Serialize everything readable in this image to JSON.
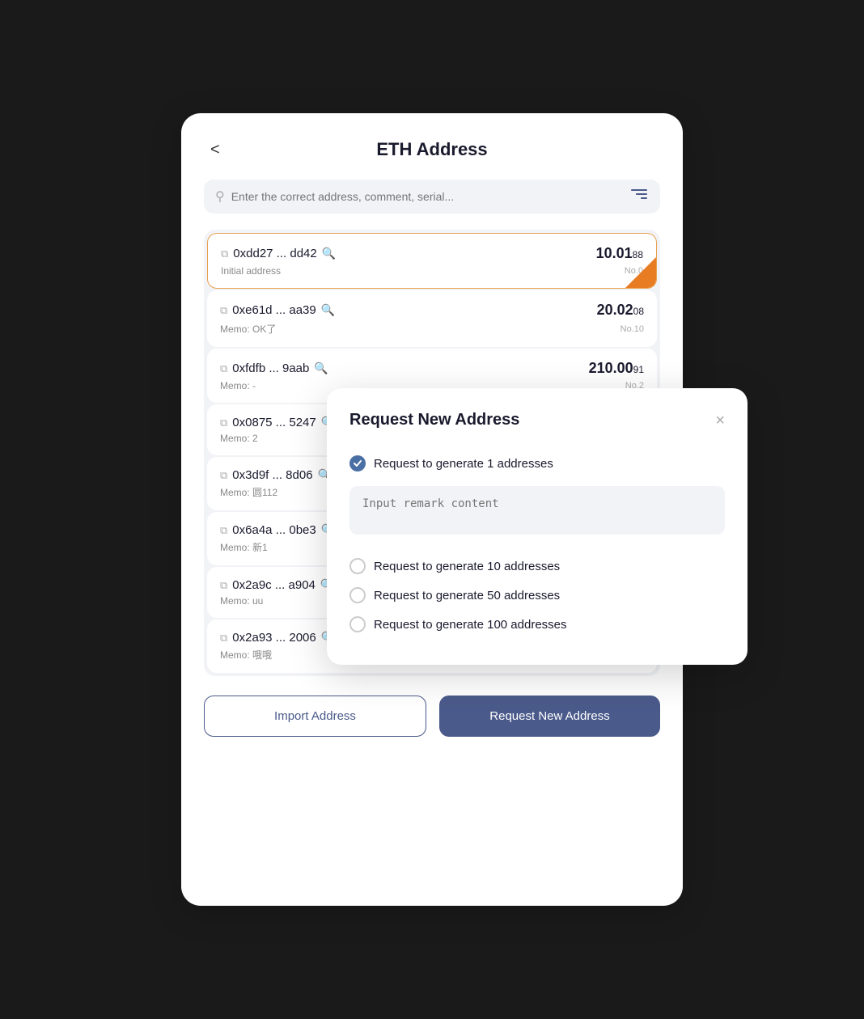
{
  "header": {
    "title": "ETH Address",
    "back_label": "<"
  },
  "search": {
    "placeholder": "Enter the correct address, comment, serial..."
  },
  "address_list": [
    {
      "address": "0xdd27 ... dd42",
      "label": "Initial address",
      "amount_main": "10.01",
      "amount_dec": "88",
      "no": "No.0",
      "active": true
    },
    {
      "address": "0xe61d ... aa39",
      "label": "Memo: OK了",
      "amount_main": "20.02",
      "amount_dec": "08",
      "no": "No.10",
      "active": false
    },
    {
      "address": "0xfdfb ... 9aab",
      "label": "Memo: -",
      "amount_main": "210.00",
      "amount_dec": "91",
      "no": "No.2",
      "active": false
    },
    {
      "address": "0x0875 ... 5247",
      "label": "Memo: 2",
      "amount_main": "",
      "amount_dec": "",
      "no": "",
      "active": false
    },
    {
      "address": "0x3d9f ... 8d06",
      "label": "Memo: 圆112",
      "amount_main": "",
      "amount_dec": "",
      "no": "",
      "active": false
    },
    {
      "address": "0x6a4a ... 0be3",
      "label": "Memo: 新1",
      "amount_main": "",
      "amount_dec": "",
      "no": "",
      "active": false
    },
    {
      "address": "0x2a9c ... a904",
      "label": "Memo: uu",
      "amount_main": "",
      "amount_dec": "",
      "no": "",
      "active": false
    },
    {
      "address": "0x2a93 ... 2006",
      "label": "Memo: 哦哦",
      "amount_main": "",
      "amount_dec": "",
      "no": "",
      "active": false
    }
  ],
  "buttons": {
    "import": "Import Address",
    "request": "Request New Address"
  },
  "modal": {
    "title": "Request New Address",
    "close_label": "×",
    "options": [
      {
        "label": "Request to generate 1 addresses",
        "checked": true
      },
      {
        "label": "Request to generate 10 addresses",
        "checked": false
      },
      {
        "label": "Request to generate 50 addresses",
        "checked": false
      },
      {
        "label": "Request to generate 100 addresses",
        "checked": false
      }
    ],
    "remark_placeholder": "Input remark content"
  }
}
